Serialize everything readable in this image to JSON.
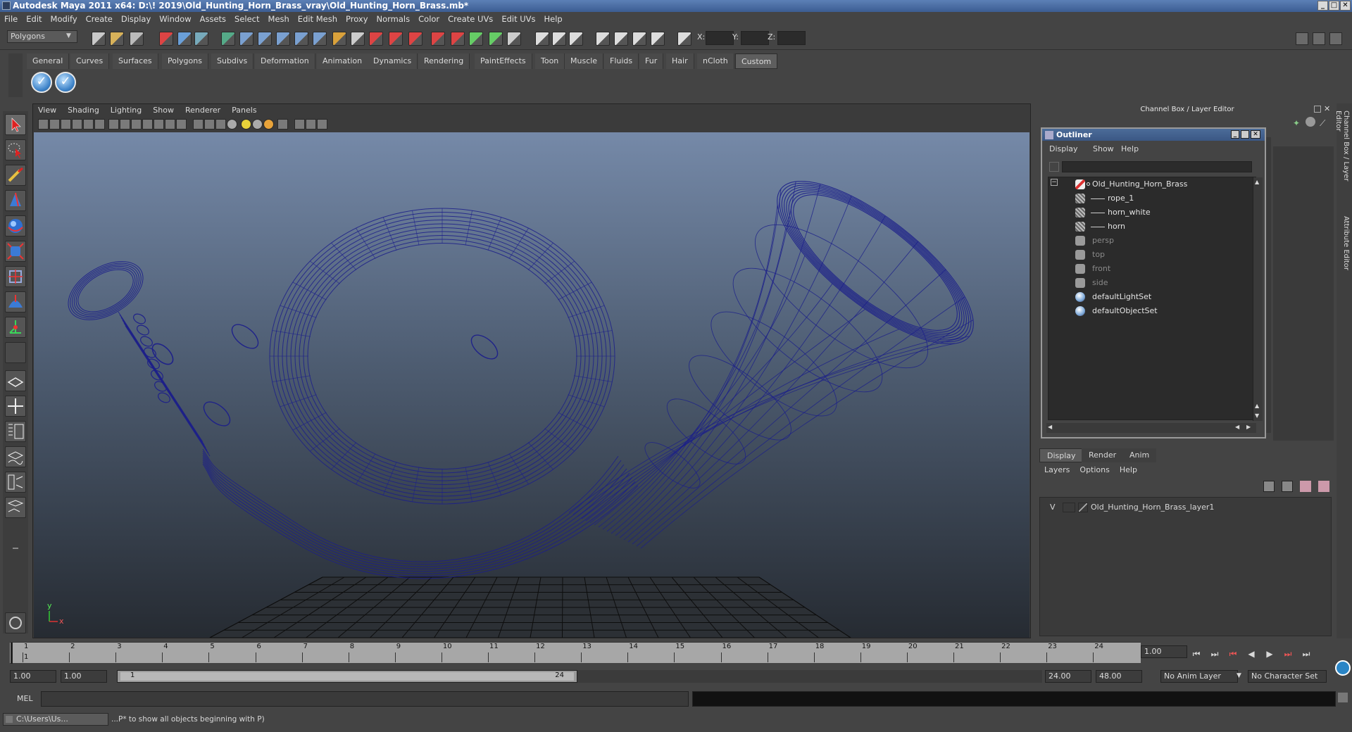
{
  "window": {
    "title": "Autodesk Maya 2011 x64: D:\\! 2019\\Old_Hunting_Horn_Brass_vray\\Old_Hunting_Horn_Brass.mb*",
    "controls": [
      "_",
      "□",
      "✕"
    ]
  },
  "menubar": [
    "File",
    "Edit",
    "Modify",
    "Create",
    "Display",
    "Window",
    "Assets",
    "Select",
    "Mesh",
    "Edit Mesh",
    "Proxy",
    "Normals",
    "Color",
    "Create UVs",
    "Edit UVs",
    "Help"
  ],
  "statusline": {
    "mode": "Polygons",
    "coord_labels": [
      "X:",
      "Y:",
      "Z:"
    ]
  },
  "shelf": {
    "tabs": [
      "General",
      "Curves",
      "Surfaces",
      "Polygons",
      "Subdivs",
      "Deformation",
      "Animation",
      "Dynamics",
      "Rendering",
      "PaintEffects",
      "Toon",
      "Muscle",
      "Fluids",
      "Fur",
      "Hair",
      "nCloth",
      "Custom"
    ],
    "active_tab": "Custom",
    "buttons": [
      "✓",
      "✓"
    ]
  },
  "viewport": {
    "menus": [
      "View",
      "Shading",
      "Lighting",
      "Show",
      "Renderer",
      "Panels"
    ],
    "axis_y": "y",
    "axis_x": "x",
    "wire_color": "#1c1f8a"
  },
  "channel_box": {
    "header": "Channel Box / Layer Editor",
    "side_tabs": [
      "Channel Box / Layer Editor",
      "Attribute Editor"
    ]
  },
  "outliner": {
    "title": "Outliner",
    "menus": [
      "Display",
      "Show",
      "Help"
    ],
    "items": [
      {
        "label": "Old_Hunting_Horn_Brass",
        "icon": "transform-icon",
        "dim": false
      },
      {
        "label": "rope_1",
        "icon": "mesh-icon",
        "dim": false
      },
      {
        "label": "horn_white",
        "icon": "mesh-icon",
        "dim": false
      },
      {
        "label": "horn",
        "icon": "mesh-icon",
        "dim": false
      },
      {
        "label": "persp",
        "icon": "camera-icon",
        "dim": true
      },
      {
        "label": "top",
        "icon": "camera-icon",
        "dim": true
      },
      {
        "label": "front",
        "icon": "camera-icon",
        "dim": true
      },
      {
        "label": "side",
        "icon": "camera-icon",
        "dim": true
      },
      {
        "label": "defaultLightSet",
        "icon": "set-icon",
        "dim": false
      },
      {
        "label": "defaultObjectSet",
        "icon": "set-icon",
        "dim": false
      }
    ],
    "collapse_symbol": "−"
  },
  "layer_editor": {
    "tabs": [
      "Display",
      "Render",
      "Anim"
    ],
    "active_tab": "Display",
    "menus": [
      "Layers",
      "Options",
      "Help"
    ],
    "layer": {
      "visible": "V",
      "name": "Old_Hunting_Horn_Brass_layer1"
    }
  },
  "timeline": {
    "ticks": [
      "1",
      "2",
      "3",
      "4",
      "5",
      "6",
      "7",
      "8",
      "9",
      "10",
      "11",
      "12",
      "13",
      "14",
      "15",
      "16",
      "17",
      "18",
      "19",
      "20",
      "21",
      "22",
      "23",
      "24"
    ],
    "current_frame": "1.00",
    "current_marker": "1"
  },
  "range": {
    "start": "1.00",
    "anim_start": "1.00",
    "range_start_label": "1",
    "range_end_label": "24",
    "anim_end": "24.00",
    "end": "48.00",
    "anim_layer": "No Anim Layer",
    "character_set": "No Character Set"
  },
  "playback": [
    "⏮",
    "⏭",
    "⏮",
    "◀",
    "▶",
    "⏭",
    "⏭"
  ],
  "command": {
    "label": "MEL"
  },
  "helpline": {
    "task": "C:\\Users\\Us...",
    "text": "...P* to show all objects beginning with P)"
  }
}
